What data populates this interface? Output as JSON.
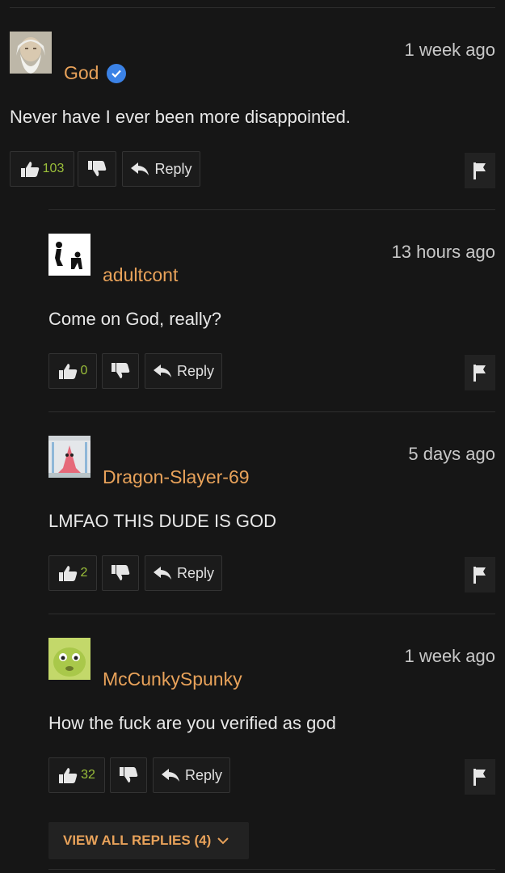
{
  "comments": [
    {
      "username": "God",
      "verified": true,
      "timestamp": "1 week ago",
      "text": "Never have I ever been more disappointed.",
      "likes": "103",
      "reply_label": "Reply",
      "avatar": "bearded-old-man-portrait"
    },
    {
      "username": "adultcont",
      "verified": false,
      "timestamp": "13 hours ago",
      "text": "Come on God, really?",
      "likes": "0",
      "reply_label": "Reply",
      "avatar": "black-figures-on-white"
    },
    {
      "username": "Dragon-Slayer-69",
      "verified": false,
      "timestamp": "5 days ago",
      "text": "LMFAO THIS DUDE IS GOD",
      "likes": "2",
      "reply_label": "Reply",
      "avatar": "pink-cartoon-star-in-room"
    },
    {
      "username": "McCunkySpunky",
      "verified": false,
      "timestamp": "1 week ago",
      "text": "How the fuck are you verified as god",
      "likes": "32",
      "reply_label": "Reply",
      "avatar": "green-cartoon-face"
    }
  ],
  "view_all_replies": "VIEW ALL REPLIES (4)",
  "colors": {
    "background": "#161616",
    "username": "#e8a25a",
    "like_count": "#9bbf3a",
    "verified_badge": "#3b82e6"
  }
}
